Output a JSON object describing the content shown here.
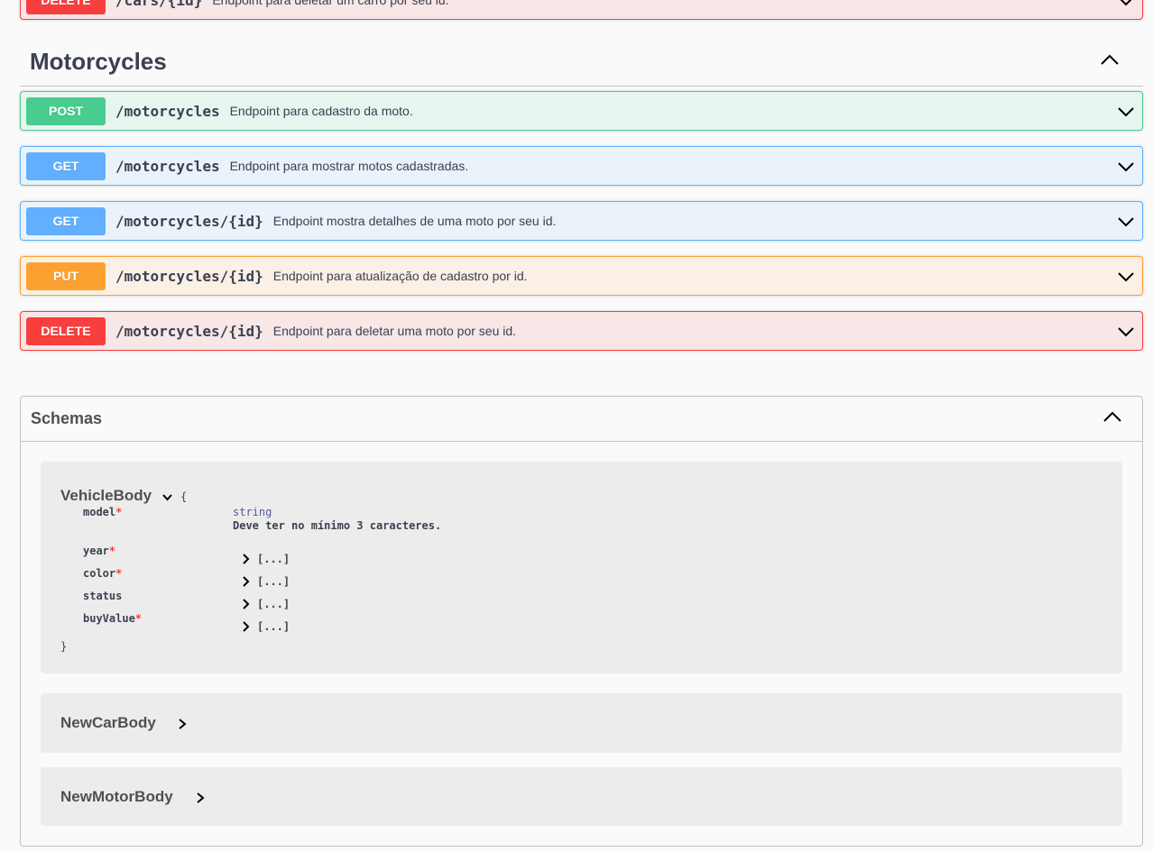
{
  "top_partial": {
    "method": "DELETE",
    "path": "/cars/{id}",
    "description": "Endpoint para deletar um carro por seu id."
  },
  "tag": {
    "title": "Motorcycles"
  },
  "operations": [
    {
      "method": "POST",
      "path": "/motorcycles",
      "description": "Endpoint para cadastro da moto."
    },
    {
      "method": "GET",
      "path": "/motorcycles",
      "description": "Endpoint para mostrar motos cadastradas."
    },
    {
      "method": "GET",
      "path": "/motorcycles/{id}",
      "description": "Endpoint mostra detalhes de uma moto por seu id."
    },
    {
      "method": "PUT",
      "path": "/motorcycles/{id}",
      "description": "Endpoint para atualização de cadastro por id."
    },
    {
      "method": "DELETE",
      "path": "/motorcycles/{id}",
      "description": "Endpoint para deletar uma moto por seu id."
    }
  ],
  "schemas": {
    "title": "Schemas",
    "vehicle_body": {
      "name": "VehicleBody",
      "open_brace": "{",
      "close_brace": "}",
      "model": {
        "name": "model",
        "required": "*",
        "type": "string",
        "note": "Deve ter no mínimo 3 caracteres."
      },
      "props": [
        {
          "name": "year",
          "required": "*",
          "value": "[...]"
        },
        {
          "name": "color",
          "required": "*",
          "value": "[...]"
        },
        {
          "name": "status",
          "required": "",
          "value": "[...]"
        },
        {
          "name": "buyValue",
          "required": "*",
          "value": "[...]"
        }
      ]
    },
    "collapsed": [
      {
        "name": "NewCarBody"
      },
      {
        "name": "NewMotorBody"
      }
    ]
  },
  "colors": {
    "post": "#49cc90",
    "get": "#61affe",
    "put": "#fca130",
    "delete": "#f93e3e"
  }
}
